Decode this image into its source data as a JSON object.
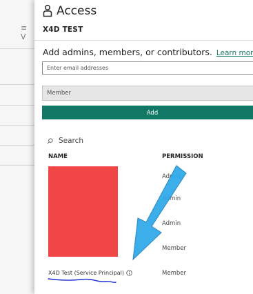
{
  "panel": {
    "title": "Access",
    "workspace_name": "X4D TEST",
    "add_heading": "Add admins, members, or contributors.",
    "learn_more": "Learn more",
    "email_placeholder": "Enter email addresses",
    "role_selected": "Member",
    "add_button": "Add",
    "search_label": "Search",
    "columns": {
      "name": "NAME",
      "permission": "PERMISSION"
    },
    "rows": [
      {
        "permission": "Admin"
      },
      {
        "permission": "Admin"
      },
      {
        "permission": "Admin"
      },
      {
        "permission": "Member"
      },
      {
        "name": "X4D Test (Service Principal)",
        "permission": "Member"
      }
    ]
  },
  "colors": {
    "accent": "#117865",
    "redaction": "#f04646",
    "arrow": "#2ea8e8",
    "underline_annotation": "#1a2bd0"
  },
  "icons": [
    "person-icon",
    "search-icon",
    "info-icon",
    "filter-lines-icon"
  ]
}
